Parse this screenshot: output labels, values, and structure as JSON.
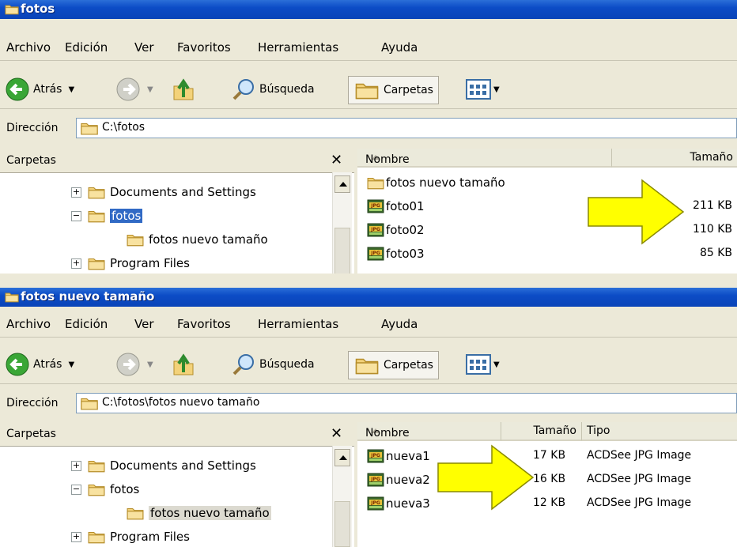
{
  "window1": {
    "title": "fotos",
    "menu": [
      "Archivo",
      "Edición",
      "Ver",
      "Favoritos",
      "Herramientas",
      "Ayuda"
    ],
    "toolbar": {
      "back": "Atrás",
      "search": "Búsqueda",
      "folders": "Carpetas"
    },
    "address": {
      "label": "Dirección",
      "path": "C:\\fotos"
    },
    "folders_pane": {
      "title": "Carpetas",
      "close": "✕",
      "tree": [
        {
          "label": "Documents and Settings",
          "expander": "+"
        },
        {
          "label": "fotos",
          "expander": "−"
        },
        {
          "label": "fotos nuevo tamaño",
          "expander": ""
        },
        {
          "label": "Program Files",
          "expander": "+"
        }
      ]
    },
    "columns": {
      "name": "Nombre",
      "size": "Tamaño"
    },
    "files": [
      {
        "name": "fotos nuevo tamaño",
        "size": "",
        "icon": "folder-icon"
      },
      {
        "name": "foto01",
        "size": "211 KB",
        "icon": "jpg-icon"
      },
      {
        "name": "foto02",
        "size": "110 KB",
        "icon": "jpg-icon"
      },
      {
        "name": "foto03",
        "size": "85 KB",
        "icon": "jpg-icon"
      }
    ]
  },
  "window2": {
    "title": "fotos nuevo tamaño",
    "menu": [
      "Archivo",
      "Edición",
      "Ver",
      "Favoritos",
      "Herramientas",
      "Ayuda"
    ],
    "toolbar": {
      "back": "Atrás",
      "search": "Búsqueda",
      "folders": "Carpetas"
    },
    "address": {
      "label": "Dirección",
      "path": "C:\\fotos\\fotos nuevo tamaño"
    },
    "folders_pane": {
      "title": "Carpetas",
      "close": "✕",
      "tree": [
        {
          "label": "Documents and Settings",
          "expander": "+"
        },
        {
          "label": "fotos",
          "expander": "−"
        },
        {
          "label": "fotos nuevo tamaño",
          "expander": ""
        },
        {
          "label": "Program Files",
          "expander": "+"
        }
      ]
    },
    "columns": {
      "name": "Nombre",
      "size": "Tamaño",
      "type": "Tipo"
    },
    "files": [
      {
        "name": "nueva1",
        "size": "17 KB",
        "type": "ACDSee JPG Image",
        "icon": "jpg-icon"
      },
      {
        "name": "nueva2",
        "size": "16 KB",
        "type": "ACDSee JPG Image",
        "icon": "jpg-icon"
      },
      {
        "name": "nueva3",
        "size": "12 KB",
        "type": "ACDSee JPG Image",
        "icon": "jpg-icon"
      }
    ]
  },
  "colors": {
    "titlebar": "#0c4cc6",
    "selection": "#316ac5",
    "arrow": "#ffff00"
  }
}
